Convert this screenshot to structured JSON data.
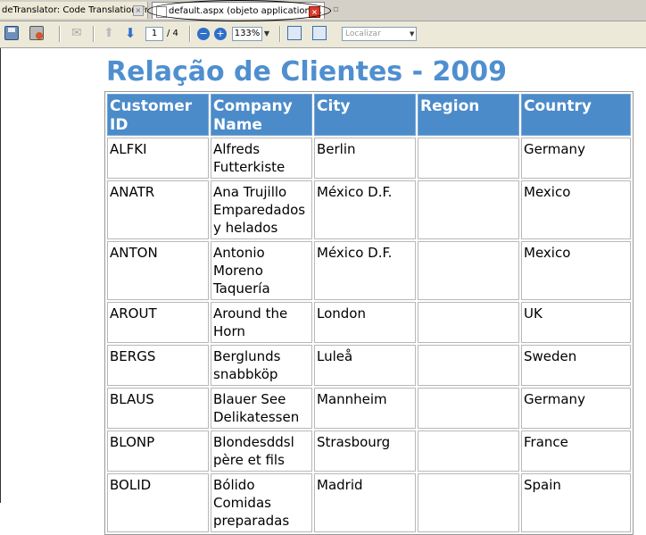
{
  "tabs": [
    {
      "label": "deTranslator: Code Translation From..."
    },
    {
      "label": "default.aspx (objeto application/..."
    }
  ],
  "toolbar": {
    "page_current": "1",
    "page_total": "/ 4",
    "zoom": "133%",
    "find_placeholder": "Localizar"
  },
  "report": {
    "title": "Relação de Clientes - 2009",
    "columns": [
      "Customer ID",
      "Company Name",
      "City",
      "Region",
      "Country"
    ],
    "rows": [
      [
        "ALFKI",
        "Alfreds Futterkiste",
        "Berlin",
        "",
        "Germany"
      ],
      [
        "ANATR",
        "Ana Trujillo Emparedados y helados",
        "México D.F.",
        "",
        "Mexico"
      ],
      [
        "ANTON",
        "Antonio Moreno Taquería",
        "México D.F.",
        "",
        "Mexico"
      ],
      [
        "AROUT",
        "Around the Horn",
        "London",
        "",
        "UK"
      ],
      [
        "BERGS",
        "Berglunds snabbköp",
        "Luleå",
        "",
        "Sweden"
      ],
      [
        "BLAUS",
        "Blauer See Delikatessen",
        "Mannheim",
        "",
        "Germany"
      ],
      [
        "BLONP",
        "Blondesddsl père et fils",
        "Strasbourg",
        "",
        "France"
      ],
      [
        "BOLID",
        "Bólido Comidas preparadas",
        "Madrid",
        "",
        "Spain"
      ]
    ]
  }
}
